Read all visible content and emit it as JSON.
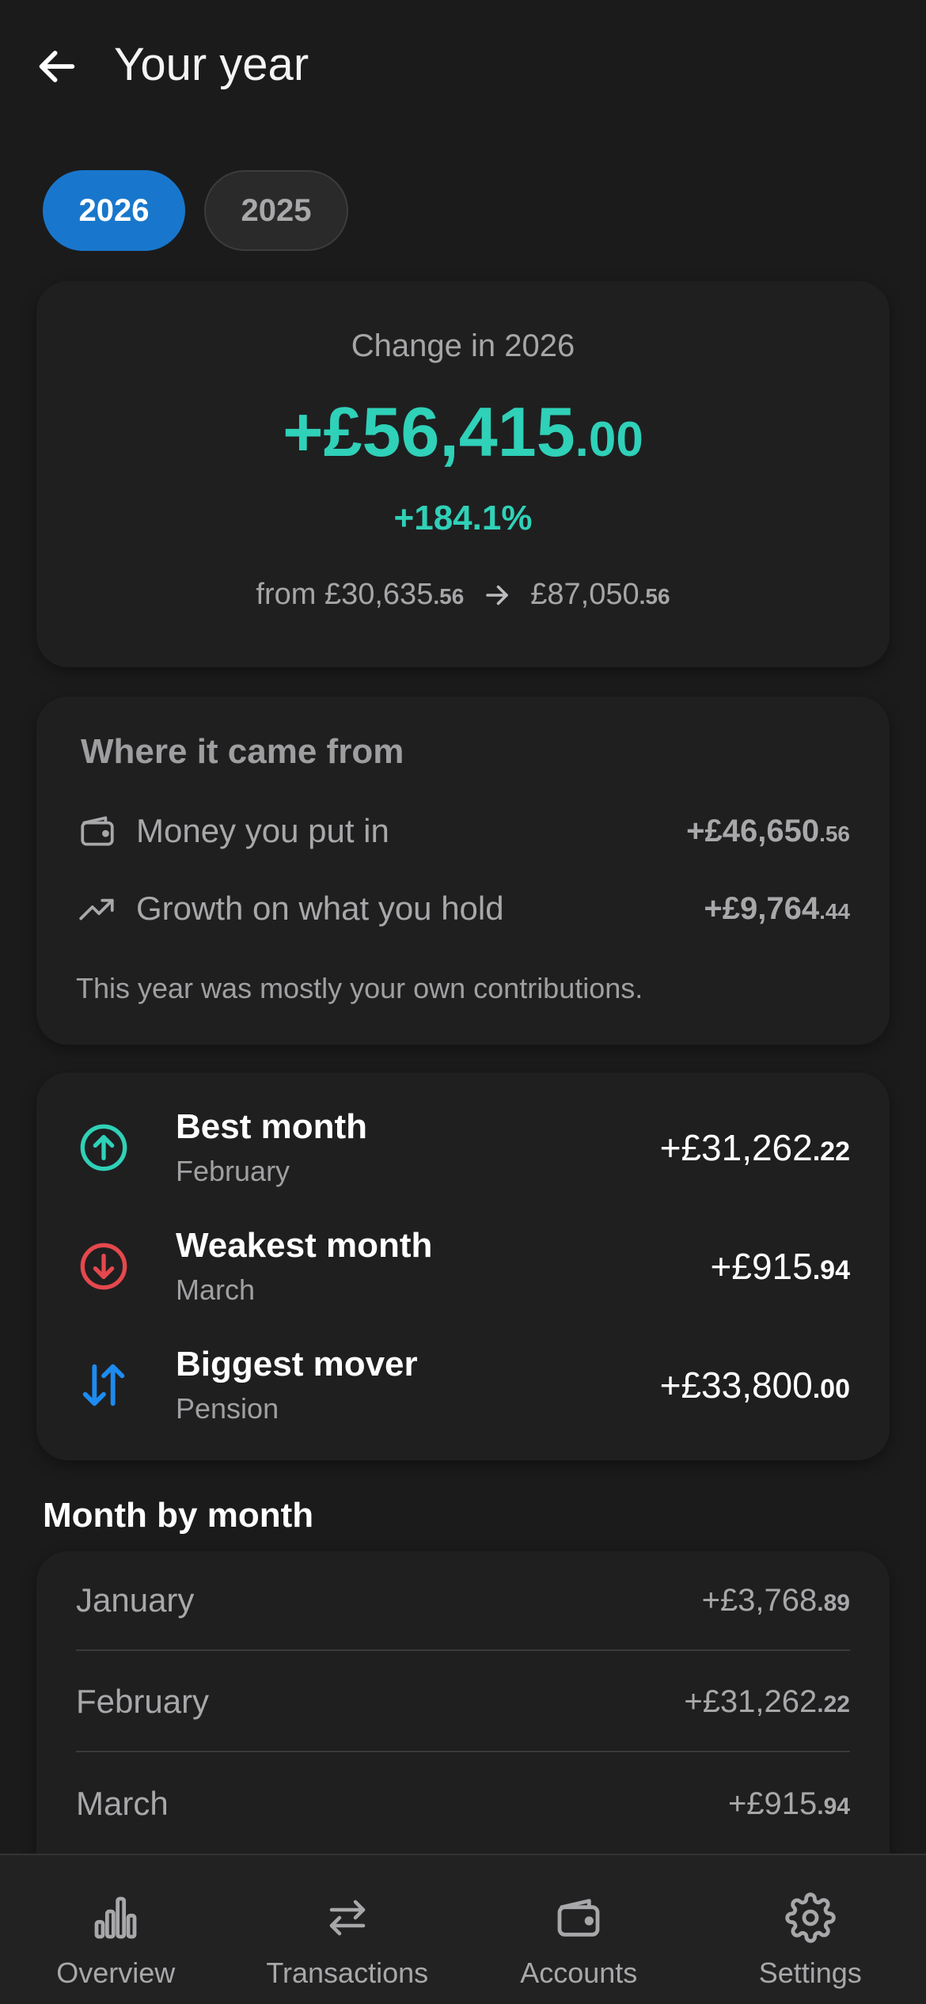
{
  "header": {
    "title": "Your year",
    "back_icon": "arrow-left-icon"
  },
  "year_tabs": [
    {
      "label": "2026",
      "selected": true
    },
    {
      "label": "2025",
      "selected": false
    }
  ],
  "change": {
    "label": "Change in 2026",
    "amount_major": "+£56,415",
    "amount_minor": ".00",
    "percent": "+184.1%",
    "from_prefix": "from ",
    "from_major": "£30,635",
    "from_minor": ".56",
    "to_major": "£87,050",
    "to_minor": ".56",
    "arrow_icon": "arrow-right-icon"
  },
  "where": {
    "title": "Where it came from",
    "rows": [
      {
        "icon": "wallet-icon",
        "label": "Money you put in",
        "amount_major": "+£46,650",
        "amount_minor": ".56"
      },
      {
        "icon": "trending-up-icon",
        "label": "Growth on what you hold",
        "amount_major": "+£9,764",
        "amount_minor": ".44"
      }
    ],
    "note": "This year was mostly your own contributions."
  },
  "highlights": [
    {
      "icon": "arrow-up-circle-icon",
      "title": "Best month",
      "subtitle": "February",
      "amount_major": "+£31,262",
      "amount_minor": ".22",
      "color": "#2fd1b8"
    },
    {
      "icon": "arrow-down-circle-icon",
      "title": "Weakest month",
      "subtitle": "March",
      "amount_major": "+£915",
      "amount_minor": ".94",
      "color": "#e5484d"
    },
    {
      "icon": "swap-vertical-icon",
      "title": "Biggest mover",
      "subtitle": "Pension",
      "amount_major": "+£33,800",
      "amount_minor": ".00",
      "color": "#1d8bf0"
    }
  ],
  "months": {
    "title": "Month by month",
    "rows": [
      {
        "name": "January",
        "amount_major": "+£3,768",
        "amount_minor": ".89"
      },
      {
        "name": "February",
        "amount_major": "+£31,262",
        "amount_minor": ".22"
      },
      {
        "name": "March",
        "amount_major": "+£915",
        "amount_minor": ".94"
      }
    ]
  },
  "nav": [
    {
      "label": "Overview",
      "icon": "bar-chart-icon"
    },
    {
      "label": "Transactions",
      "icon": "swap-arrows-icon"
    },
    {
      "label": "Accounts",
      "icon": "wallet-icon"
    },
    {
      "label": "Settings",
      "icon": "gear-icon"
    }
  ],
  "colors": {
    "accent": "#1877cc",
    "positive": "#2fd1b8",
    "negative": "#e5484d",
    "mover": "#1d8bf0",
    "background": "#1b1b1c"
  }
}
